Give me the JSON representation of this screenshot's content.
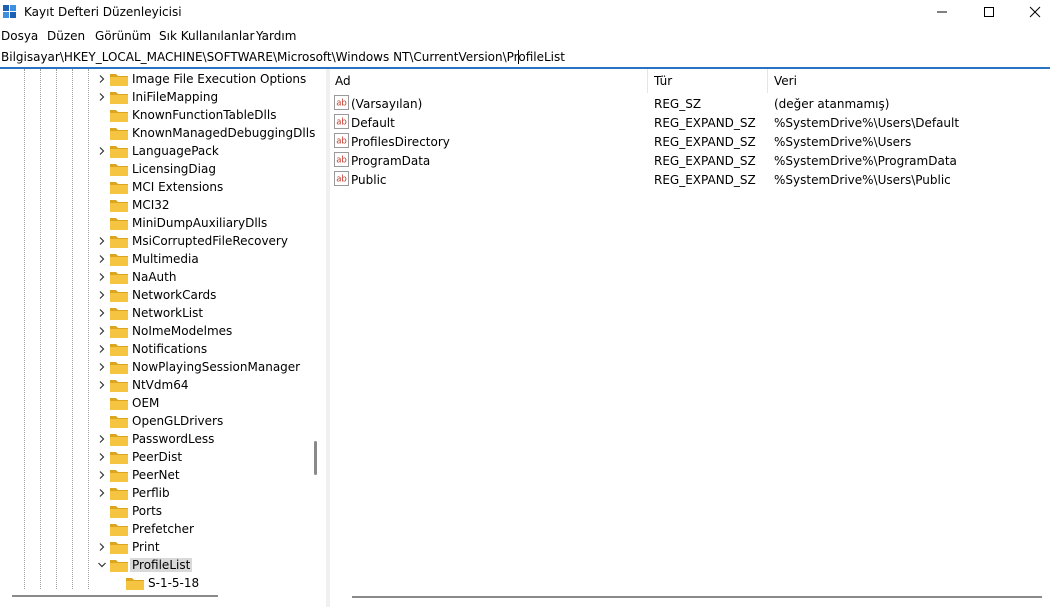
{
  "window": {
    "title": "Kayıt Defteri Düzenleyicisi",
    "icon": "registry-editor-icon",
    "controls": [
      "minimize-icon",
      "maximize-icon",
      "close-icon"
    ]
  },
  "menu": [
    "Dosya",
    "Düzen",
    "Görünüm",
    "Sık Kullanılanlar",
    "Yardım"
  ],
  "address": "Bilgisayar\\HKEY_LOCAL_MACHINE\\SOFTWARE\\Microsoft\\Windows NT\\CurrentVersion\\ProfileList",
  "tree": {
    "items": [
      {
        "label": "Image File Execution Options",
        "expander": true
      },
      {
        "label": "IniFileMapping",
        "expander": true
      },
      {
        "label": "KnownFunctionTableDlls",
        "expander": false
      },
      {
        "label": "KnownManagedDebuggingDlls",
        "expander": false
      },
      {
        "label": "LanguagePack",
        "expander": true
      },
      {
        "label": "LicensingDiag",
        "expander": false
      },
      {
        "label": "MCI Extensions",
        "expander": false
      },
      {
        "label": "MCI32",
        "expander": false
      },
      {
        "label": "MiniDumpAuxiliaryDlls",
        "expander": false
      },
      {
        "label": "MsiCorruptedFileRecovery",
        "expander": true
      },
      {
        "label": "Multimedia",
        "expander": true
      },
      {
        "label": "NaAuth",
        "expander": true
      },
      {
        "label": "NetworkCards",
        "expander": true
      },
      {
        "label": "NetworkList",
        "expander": true
      },
      {
        "label": "NoImeModelmes",
        "expander": true
      },
      {
        "label": "Notifications",
        "expander": true
      },
      {
        "label": "NowPlayingSessionManager",
        "expander": true
      },
      {
        "label": "NtVdm64",
        "expander": true
      },
      {
        "label": "OEM",
        "expander": false
      },
      {
        "label": "OpenGLDrivers",
        "expander": false
      },
      {
        "label": "PasswordLess",
        "expander": true
      },
      {
        "label": "PeerDist",
        "expander": true
      },
      {
        "label": "PeerNet",
        "expander": true
      },
      {
        "label": "Perflib",
        "expander": true
      },
      {
        "label": "Ports",
        "expander": false
      },
      {
        "label": "Prefetcher",
        "expander": false
      },
      {
        "label": "Print",
        "expander": true
      },
      {
        "label": "ProfileList",
        "expander": true,
        "expanded": true,
        "selected": true
      },
      {
        "label": "S-1-5-18",
        "expander": false,
        "child": true
      }
    ]
  },
  "list": {
    "columns": [
      "Ad",
      "Tür",
      "Veri"
    ],
    "rows": [
      {
        "name": "(Varsayılan)",
        "type": "REG_SZ",
        "data": "(değer atanmamış)"
      },
      {
        "name": "Default",
        "type": "REG_EXPAND_SZ",
        "data": "%SystemDrive%\\Users\\Default"
      },
      {
        "name": "ProfilesDirectory",
        "type": "REG_EXPAND_SZ",
        "data": "%SystemDrive%\\Users"
      },
      {
        "name": "ProgramData",
        "type": "REG_EXPAND_SZ",
        "data": "%SystemDrive%\\ProgramData"
      },
      {
        "name": "Public",
        "type": "REG_EXPAND_SZ",
        "data": "%SystemDrive%\\Users\\Public"
      }
    ],
    "value_icon": "string-value-icon",
    "value_icon_text": "ab"
  },
  "colors": {
    "accent": "#2a72c4",
    "folder": "#f5c542",
    "folder_dark": "#dba520",
    "selection": "#d9d9d9",
    "value_icon_text": "#c0392b"
  }
}
